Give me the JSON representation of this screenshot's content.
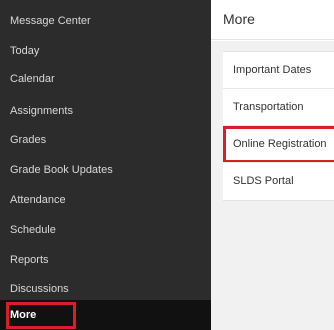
{
  "sidebar": {
    "items": [
      {
        "label": "Message Center"
      },
      {
        "label": "Today"
      },
      {
        "label": "Calendar"
      },
      {
        "label": "Assignments"
      },
      {
        "label": "Grades"
      },
      {
        "label": "Grade Book Updates"
      },
      {
        "label": "Attendance"
      },
      {
        "label": "Schedule"
      },
      {
        "label": "Reports"
      },
      {
        "label": "Discussions"
      },
      {
        "label": "More"
      }
    ],
    "active": "More"
  },
  "header": {
    "title": "More"
  },
  "more_menu": {
    "items": [
      {
        "label": "Important Dates"
      },
      {
        "label": "Transportation"
      },
      {
        "label": "Online Registration"
      },
      {
        "label": "SLDS Portal"
      }
    ],
    "highlighted": "Online Registration"
  },
  "colors": {
    "sidebar_bg": "#2c2c2c",
    "active_bg": "#111111",
    "highlight": "#d81e26",
    "content_bg": "#f1f1f1"
  }
}
